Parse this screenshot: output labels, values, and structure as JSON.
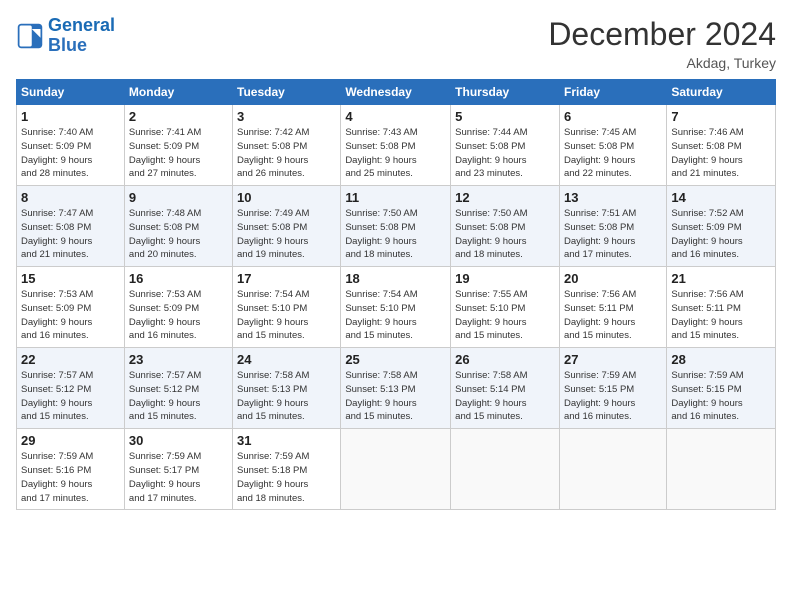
{
  "logo": {
    "line1": "General",
    "line2": "Blue"
  },
  "title": "December 2024",
  "subtitle": "Akdag, Turkey",
  "header_days": [
    "Sunday",
    "Monday",
    "Tuesday",
    "Wednesday",
    "Thursday",
    "Friday",
    "Saturday"
  ],
  "weeks": [
    [
      {
        "day": "1",
        "info": "Sunrise: 7:40 AM\nSunset: 5:09 PM\nDaylight: 9 hours\nand 28 minutes."
      },
      {
        "day": "2",
        "info": "Sunrise: 7:41 AM\nSunset: 5:09 PM\nDaylight: 9 hours\nand 27 minutes."
      },
      {
        "day": "3",
        "info": "Sunrise: 7:42 AM\nSunset: 5:08 PM\nDaylight: 9 hours\nand 26 minutes."
      },
      {
        "day": "4",
        "info": "Sunrise: 7:43 AM\nSunset: 5:08 PM\nDaylight: 9 hours\nand 25 minutes."
      },
      {
        "day": "5",
        "info": "Sunrise: 7:44 AM\nSunset: 5:08 PM\nDaylight: 9 hours\nand 23 minutes."
      },
      {
        "day": "6",
        "info": "Sunrise: 7:45 AM\nSunset: 5:08 PM\nDaylight: 9 hours\nand 22 minutes."
      },
      {
        "day": "7",
        "info": "Sunrise: 7:46 AM\nSunset: 5:08 PM\nDaylight: 9 hours\nand 21 minutes."
      }
    ],
    [
      {
        "day": "8",
        "info": "Sunrise: 7:47 AM\nSunset: 5:08 PM\nDaylight: 9 hours\nand 21 minutes."
      },
      {
        "day": "9",
        "info": "Sunrise: 7:48 AM\nSunset: 5:08 PM\nDaylight: 9 hours\nand 20 minutes."
      },
      {
        "day": "10",
        "info": "Sunrise: 7:49 AM\nSunset: 5:08 PM\nDaylight: 9 hours\nand 19 minutes."
      },
      {
        "day": "11",
        "info": "Sunrise: 7:50 AM\nSunset: 5:08 PM\nDaylight: 9 hours\nand 18 minutes."
      },
      {
        "day": "12",
        "info": "Sunrise: 7:50 AM\nSunset: 5:08 PM\nDaylight: 9 hours\nand 18 minutes."
      },
      {
        "day": "13",
        "info": "Sunrise: 7:51 AM\nSunset: 5:08 PM\nDaylight: 9 hours\nand 17 minutes."
      },
      {
        "day": "14",
        "info": "Sunrise: 7:52 AM\nSunset: 5:09 PM\nDaylight: 9 hours\nand 16 minutes."
      }
    ],
    [
      {
        "day": "15",
        "info": "Sunrise: 7:53 AM\nSunset: 5:09 PM\nDaylight: 9 hours\nand 16 minutes."
      },
      {
        "day": "16",
        "info": "Sunrise: 7:53 AM\nSunset: 5:09 PM\nDaylight: 9 hours\nand 16 minutes."
      },
      {
        "day": "17",
        "info": "Sunrise: 7:54 AM\nSunset: 5:10 PM\nDaylight: 9 hours\nand 15 minutes."
      },
      {
        "day": "18",
        "info": "Sunrise: 7:54 AM\nSunset: 5:10 PM\nDaylight: 9 hours\nand 15 minutes."
      },
      {
        "day": "19",
        "info": "Sunrise: 7:55 AM\nSunset: 5:10 PM\nDaylight: 9 hours\nand 15 minutes."
      },
      {
        "day": "20",
        "info": "Sunrise: 7:56 AM\nSunset: 5:11 PM\nDaylight: 9 hours\nand 15 minutes."
      },
      {
        "day": "21",
        "info": "Sunrise: 7:56 AM\nSunset: 5:11 PM\nDaylight: 9 hours\nand 15 minutes."
      }
    ],
    [
      {
        "day": "22",
        "info": "Sunrise: 7:57 AM\nSunset: 5:12 PM\nDaylight: 9 hours\nand 15 minutes."
      },
      {
        "day": "23",
        "info": "Sunrise: 7:57 AM\nSunset: 5:12 PM\nDaylight: 9 hours\nand 15 minutes."
      },
      {
        "day": "24",
        "info": "Sunrise: 7:58 AM\nSunset: 5:13 PM\nDaylight: 9 hours\nand 15 minutes."
      },
      {
        "day": "25",
        "info": "Sunrise: 7:58 AM\nSunset: 5:13 PM\nDaylight: 9 hours\nand 15 minutes."
      },
      {
        "day": "26",
        "info": "Sunrise: 7:58 AM\nSunset: 5:14 PM\nDaylight: 9 hours\nand 15 minutes."
      },
      {
        "day": "27",
        "info": "Sunrise: 7:59 AM\nSunset: 5:15 PM\nDaylight: 9 hours\nand 16 minutes."
      },
      {
        "day": "28",
        "info": "Sunrise: 7:59 AM\nSunset: 5:15 PM\nDaylight: 9 hours\nand 16 minutes."
      }
    ],
    [
      {
        "day": "29",
        "info": "Sunrise: 7:59 AM\nSunset: 5:16 PM\nDaylight: 9 hours\nand 17 minutes."
      },
      {
        "day": "30",
        "info": "Sunrise: 7:59 AM\nSunset: 5:17 PM\nDaylight: 9 hours\nand 17 minutes."
      },
      {
        "day": "31",
        "info": "Sunrise: 7:59 AM\nSunset: 5:18 PM\nDaylight: 9 hours\nand 18 minutes."
      },
      null,
      null,
      null,
      null
    ]
  ]
}
